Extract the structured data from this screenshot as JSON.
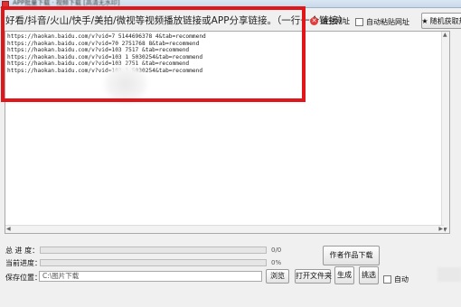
{
  "window": {
    "title": "APP批量下载 · 视频下载 [高清无水印]"
  },
  "header": {
    "instruction": "好看/抖音/火山/快手/美拍/微视等视频播放链接或APP分享链接。（一行一个链接）",
    "clear_label": "清空网址",
    "auto_paste_label": "自动粘贴网址",
    "random_label": "随机获取热"
  },
  "url_list": [
    "https://haokan.baidu.com/v?vid=7  5144696378     4&tab=recommend",
    "https://haokan.baidu.com/v?vid=70   2751768    8&tab=recommend",
    "https://haokan.baidu.com/v?vid=103   7517         &tab=recommend",
    "https://haokan.baidu.com/v?vid=103  1   5030254&tab=recommend",
    "https://haokan.baidu.com/v?vid=103   2751        &tab=recommend",
    "https://haokan.baidu.com/v?vid=103  1    5030254&tab=recommend"
  ],
  "progress": {
    "total_label": "总 进 度：",
    "total_value": "0/0",
    "total_fraction": 0,
    "current_label": "当前进度：",
    "current_value": "0%",
    "current_fraction": 0
  },
  "footer": {
    "author_download_label": "作者作品下载",
    "save_label": "保存位置：",
    "save_path": "C:\\图片下载",
    "browse_label": "浏览",
    "open_folder_label": "打开文件夹",
    "generate_label": "生成",
    "pick_label": "挑选",
    "auto_label": "自动"
  },
  "colors": {
    "highlight_frame": "#e0161a",
    "clear_icon": "#e23b3b"
  }
}
